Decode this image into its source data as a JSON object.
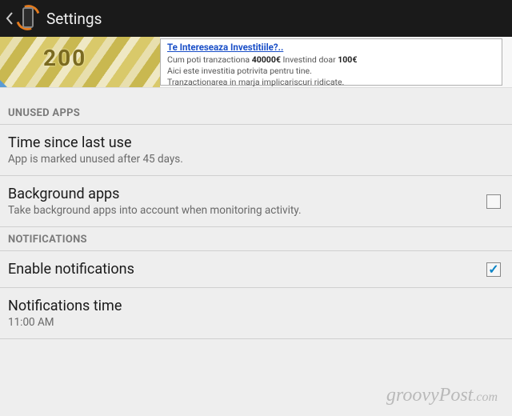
{
  "header": {
    "title": "Settings"
  },
  "ad": {
    "title": "Te Intereseaza Investitiile?..",
    "line1_pre": "Cum poti tranzactiona ",
    "line1_bold": "40000€",
    "line1_mid": " Investind doar ",
    "line1_bold2": "100€",
    "line2": "Aici este investitia potrivita pentru tine.",
    "line3": "Tranzactionarea in marja implicariscuri ridicate."
  },
  "sections": {
    "unused_apps": {
      "header": "UNUSED APPS",
      "time_since": {
        "title": "Time since last use",
        "summary": "App is marked unused after 45 days."
      },
      "background_apps": {
        "title": "Background apps",
        "summary": "Take background apps into account when monitoring activity.",
        "checked": false
      }
    },
    "notifications": {
      "header": "NOTIFICATIONS",
      "enable": {
        "title": "Enable notifications",
        "checked": true
      },
      "time": {
        "title": "Notifications time",
        "summary": "11:00 AM"
      }
    }
  },
  "watermark": {
    "brand": "groovy",
    "brand2": "Post",
    "tld": ".com"
  }
}
